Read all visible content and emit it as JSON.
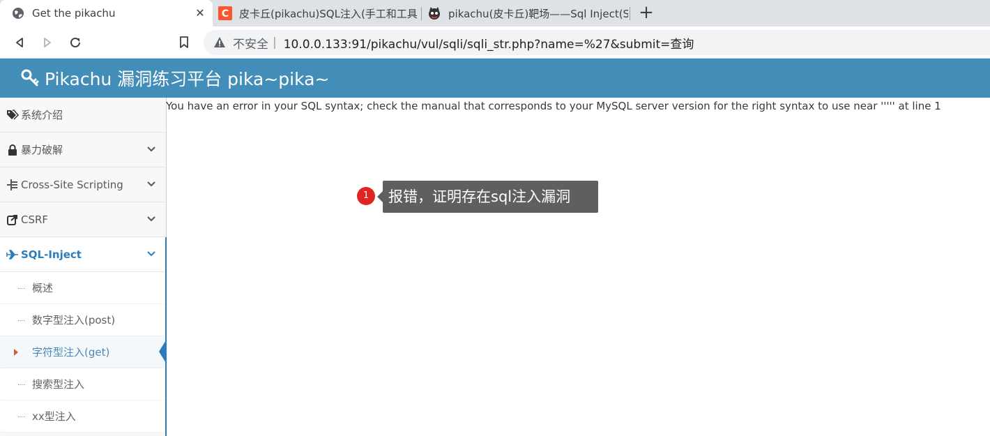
{
  "browser": {
    "tabs": [
      {
        "title": "Get the pikachu",
        "favicon": "globe-icon",
        "active": true
      },
      {
        "title": "皮卡丘(pikachu)SQL注入(手工和工具",
        "favicon": "csdn-icon",
        "active": false
      },
      {
        "title": "pikachu(皮卡丘)靶场——Sql Inject(S",
        "favicon": "cat-avatar-icon",
        "active": false
      }
    ],
    "new_tab_label": "+",
    "close_label": "✕",
    "address": {
      "insecure_label": "不安全",
      "separator": "|",
      "url": "10.0.0.133:91/pikachu/vul/sqli/sqli_str.php?name=%27&submit=查询"
    }
  },
  "header": {
    "title": "Pikachu 漏洞练习平台 pika~pika~",
    "bg_color": "#438eb9"
  },
  "sidebar": {
    "items": [
      {
        "label": "系统介绍",
        "icon": "tags-icon"
      },
      {
        "label": "暴力破解",
        "icon": "lock-icon"
      },
      {
        "label": "Cross-Site Scripting",
        "icon": "sitemap-icon"
      },
      {
        "label": "CSRF",
        "icon": "share-icon"
      },
      {
        "label": "SQL-Inject",
        "icon": "plane-icon"
      }
    ],
    "sub_items": [
      {
        "label": "概述"
      },
      {
        "label": "数字型注入(post)"
      },
      {
        "label": "字符型注入(get)"
      },
      {
        "label": "搜索型注入"
      },
      {
        "label": "xx型注入"
      }
    ]
  },
  "main": {
    "error_message": "You have an error in your SQL syntax; check the manual that corresponds to your MySQL server version for the right syntax to use near ''''' at line 1"
  },
  "annotation": {
    "number": "1",
    "text": "报错，证明存在sql注入漏洞"
  }
}
